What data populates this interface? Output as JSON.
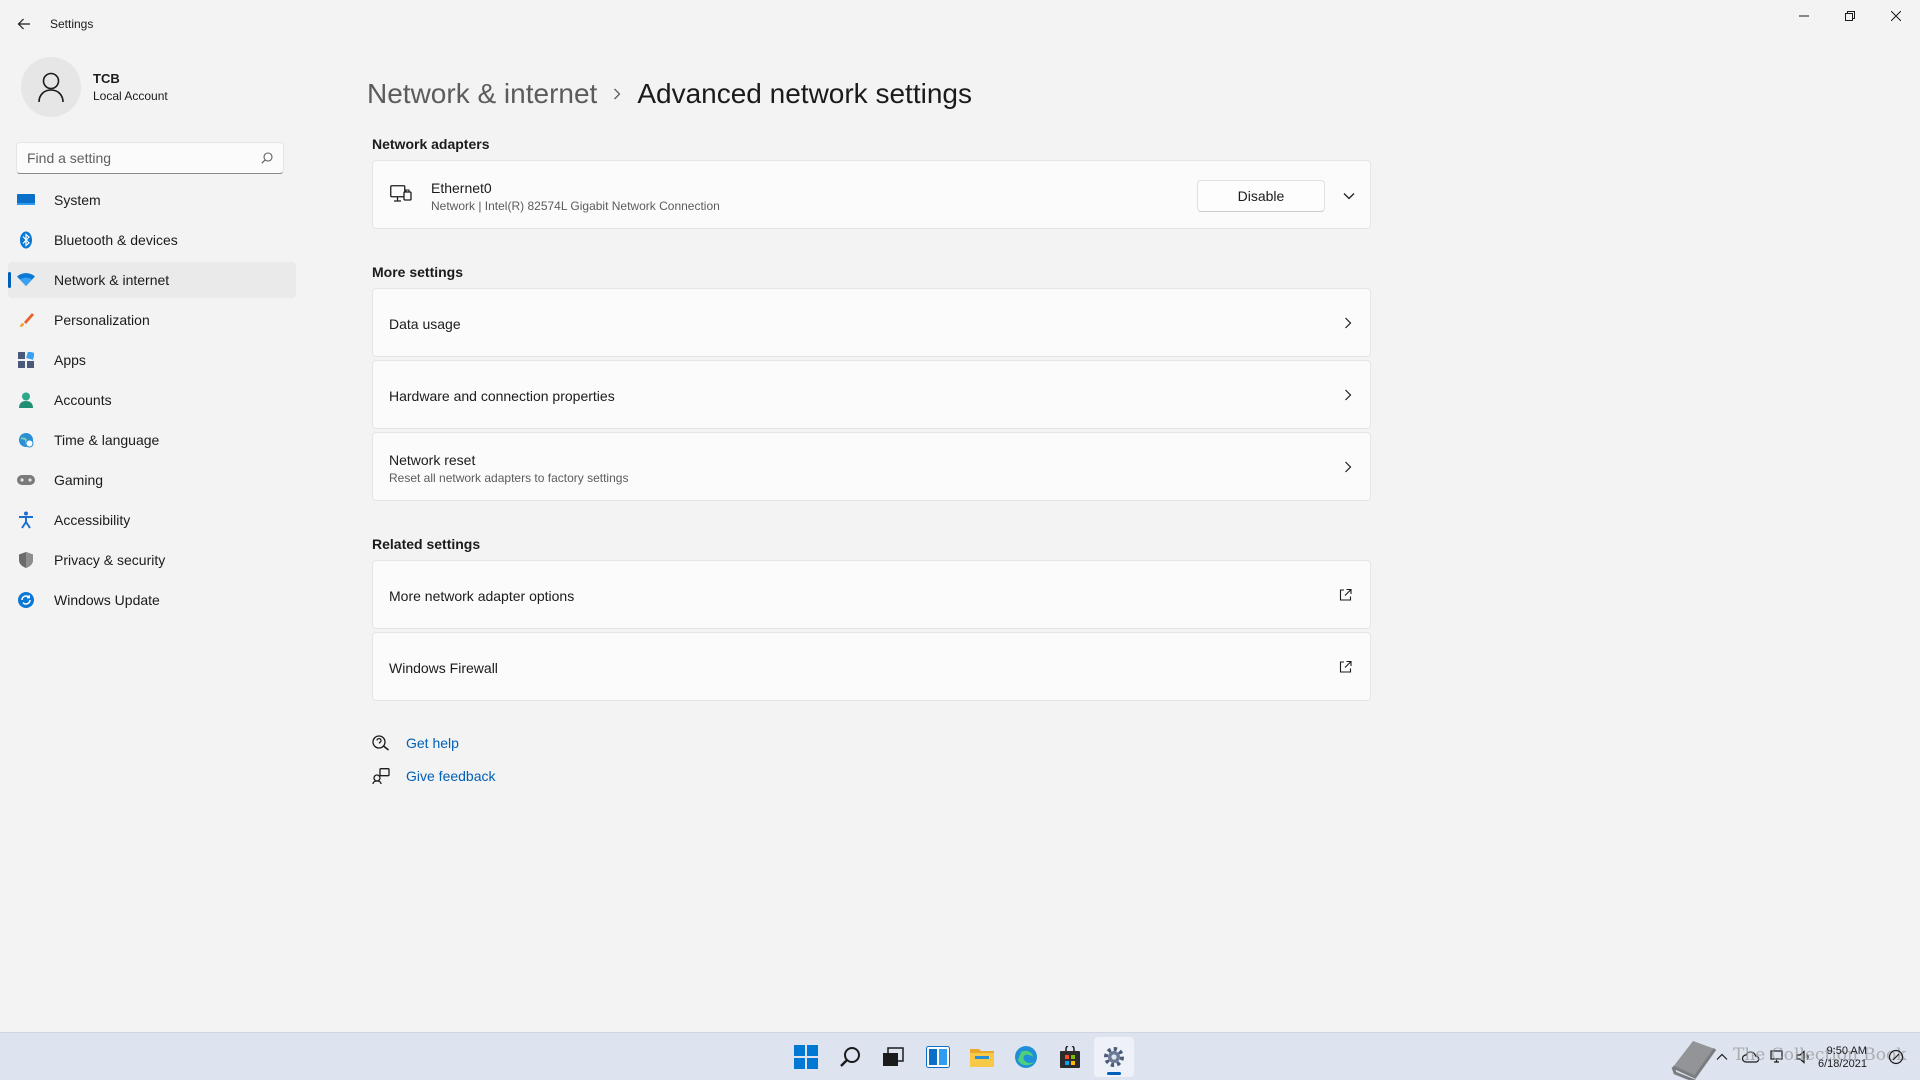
{
  "window": {
    "title": "Settings"
  },
  "profile": {
    "name": "TCB",
    "account_type": "Local Account"
  },
  "search": {
    "placeholder": "Find a setting"
  },
  "sidebar": {
    "items": [
      {
        "label": "System",
        "icon": "display-icon",
        "color": "#0078d4"
      },
      {
        "label": "Bluetooth & devices",
        "icon": "bluetooth-icon",
        "color": "#0078d4"
      },
      {
        "label": "Network & internet",
        "icon": "wifi-icon",
        "color": "#0078d4",
        "active": true
      },
      {
        "label": "Personalization",
        "icon": "brush-icon",
        "color": "#e8612c"
      },
      {
        "label": "Apps",
        "icon": "apps-icon",
        "color": "#4a5a78"
      },
      {
        "label": "Accounts",
        "icon": "person-icon",
        "color": "#2ea88a"
      },
      {
        "label": "Time & language",
        "icon": "globe-clock-icon",
        "color": "#2b8fd6"
      },
      {
        "label": "Gaming",
        "icon": "gamepad-icon",
        "color": "#7a7a7a"
      },
      {
        "label": "Accessibility",
        "icon": "accessibility-icon",
        "color": "#1f6fd1"
      },
      {
        "label": "Privacy & security",
        "icon": "shield-icon",
        "color": "#6b6b6b"
      },
      {
        "label": "Windows Update",
        "icon": "update-icon",
        "color": "#0a78d4"
      }
    ]
  },
  "breadcrumb": {
    "parent": "Network & internet",
    "current": "Advanced network settings"
  },
  "adapters": {
    "section_title": "Network adapters",
    "items": [
      {
        "name": "Ethernet0",
        "description": "Network | Intel(R) 82574L Gigabit Network Connection",
        "button_label": "Disable"
      }
    ]
  },
  "more_settings": {
    "section_title": "More settings",
    "items": [
      {
        "title": "Data usage",
        "subtitle": ""
      },
      {
        "title": "Hardware and connection properties",
        "subtitle": ""
      },
      {
        "title": "Network reset",
        "subtitle": "Reset all network adapters to factory settings"
      }
    ]
  },
  "related_settings": {
    "section_title": "Related settings",
    "items": [
      {
        "title": "More network adapter options"
      },
      {
        "title": "Windows Firewall"
      }
    ]
  },
  "help": {
    "get_help": "Get help",
    "give_feedback": "Give feedback"
  },
  "taskbar": {
    "clock_time": "9:50 AM",
    "clock_date": "6/18/2021",
    "watermark_text": "The Collection Book"
  },
  "colors": {
    "accent": "#005fb8",
    "background": "#f3f3f3",
    "card": "#fbfbfb",
    "taskbar": "#dde4ef"
  }
}
